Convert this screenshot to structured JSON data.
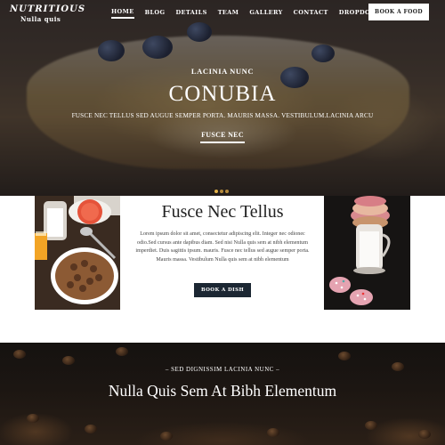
{
  "brand": {
    "title": "NUTRITIOUS",
    "subtitle": "Nulla quis"
  },
  "nav": {
    "items": [
      {
        "label": "HOME"
      },
      {
        "label": "BLOG"
      },
      {
        "label": "DETAILS"
      },
      {
        "label": "TEAM"
      },
      {
        "label": "GALLERY"
      },
      {
        "label": "CONTACT"
      },
      {
        "label": "DROPDOWN"
      }
    ],
    "book_label": "BOOK A FOOD"
  },
  "hero": {
    "kicker": "LACINIA NUNC",
    "title": "CONUBIA",
    "subtitle": "FUSCE NEC TELLUS SED AUGUE SEMPER PORTA. MAURIS MASSA. VESTIBULUM.LACINIA ARCU",
    "link_label": "FUSCE NEC",
    "slides": 3
  },
  "about": {
    "title": "Fusce Nec Tellus",
    "text": "Lorem ipsum dolor sit amet, consectetur adipiscing elit. Integer nec odionec odio.Sed cursus ante dapibus diam. Sed nisi Nulla quis sem at nibh elementum imperdiet. Duis sagittis ipsum. mauris. Fusce nec tellus sed augue semper porta. Mauris massa. Vestibulum Nulla quis sem at nibh elementum",
    "button_label": "BOOK A DISH"
  },
  "coffee": {
    "kicker": "– SED DIGNISSIM LACINIA NUNC –",
    "title": "Nulla Quis Sem At Bibh Elementum"
  },
  "colors": {
    "accent": "#e3b247",
    "button_dark": "#1c2733"
  },
  "icons": {
    "dropdown": "chevron-down-icon"
  }
}
